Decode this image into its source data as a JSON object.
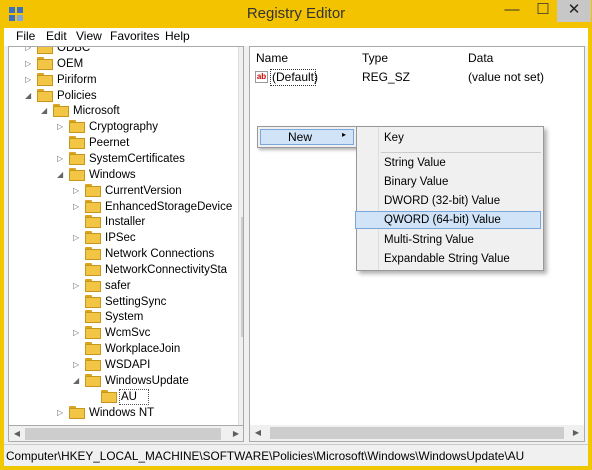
{
  "window": {
    "title": "Registry Editor",
    "min": "—",
    "max": "☐",
    "close": "✕",
    "accent": "#f3c300"
  },
  "menu": [
    "File",
    "Edit",
    "View",
    "Favorites",
    "Help"
  ],
  "tree": [
    {
      "label": "ODBC",
      "exp": "▷"
    },
    {
      "label": "OEM",
      "exp": "▷"
    },
    {
      "label": "Piriform",
      "exp": "▷"
    },
    {
      "label": "Policies",
      "exp": "◢"
    },
    {
      "label": "Microsoft",
      "exp": "◢"
    },
    {
      "label": "Cryptography",
      "exp": "▷"
    },
    {
      "label": "Peernet",
      "exp": ""
    },
    {
      "label": "SystemCertificates",
      "exp": "▷"
    },
    {
      "label": "Windows",
      "exp": "◢"
    },
    {
      "label": "CurrentVersion",
      "exp": "▷"
    },
    {
      "label": "EnhancedStorageDevice",
      "exp": "▷"
    },
    {
      "label": "Installer",
      "exp": ""
    },
    {
      "label": "IPSec",
      "exp": "▷"
    },
    {
      "label": "Network Connections",
      "exp": ""
    },
    {
      "label": "NetworkConnectivitySta",
      "exp": ""
    },
    {
      "label": "safer",
      "exp": "▷"
    },
    {
      "label": "SettingSync",
      "exp": ""
    },
    {
      "label": "System",
      "exp": ""
    },
    {
      "label": "WcmSvc",
      "exp": "▷"
    },
    {
      "label": "WorkplaceJoin",
      "exp": ""
    },
    {
      "label": "WSDAPI",
      "exp": "▷"
    },
    {
      "label": "WindowsUpdate",
      "exp": "◢"
    },
    {
      "label": "AU",
      "exp": ""
    },
    {
      "label": "Windows NT",
      "exp": "▷"
    }
  ],
  "list": {
    "headers": {
      "name": "Name",
      "type": "Type",
      "data": "Data"
    },
    "rows": [
      {
        "icon": "ab",
        "name": "(Default)",
        "type": "REG_SZ",
        "data": "(value not set)"
      }
    ]
  },
  "context_menu": {
    "new_label": "New",
    "new_arrow": "▸",
    "submenu": [
      "Key",
      "String Value",
      "Binary Value",
      "DWORD (32-bit) Value",
      "QWORD (64-bit) Value",
      "Multi-String Value",
      "Expandable String Value"
    ],
    "highlighted": "QWORD (64-bit) Value"
  },
  "status": "Computer\\HKEY_LOCAL_MACHINE\\SOFTWARE\\Policies\\Microsoft\\Windows\\WindowsUpdate\\AU"
}
